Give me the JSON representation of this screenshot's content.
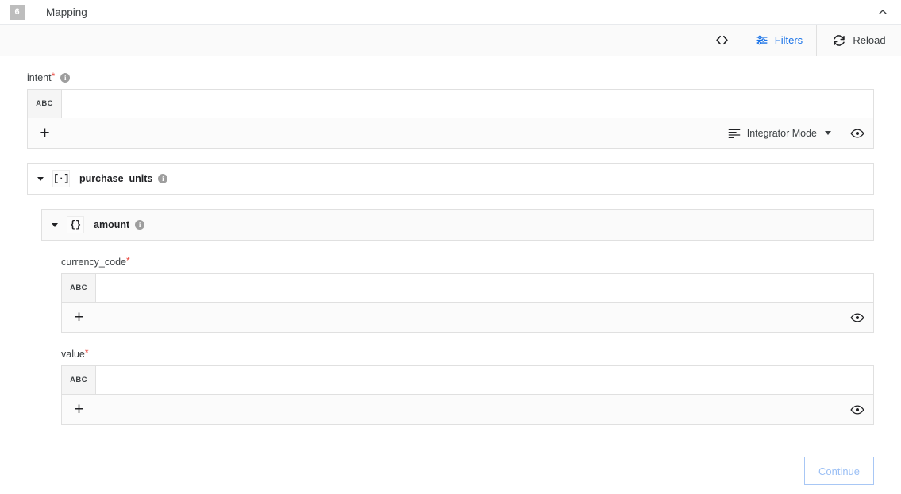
{
  "header": {
    "step_number": "6",
    "title": "Mapping",
    "collapse_icon": "chevron-up-icon"
  },
  "toolbar": {
    "code_icon": "code-brackets-icon",
    "filters_label": "Filters",
    "filters_icon": "tune-sliders-icon",
    "filters_color": "#1a73e8",
    "reload_label": "Reload",
    "reload_icon": "sync-refresh-icon"
  },
  "fields": {
    "intent": {
      "label": "intent",
      "required": "*",
      "has_info": true,
      "info_glyph": "i",
      "type_badge": "ABC",
      "value": "",
      "placeholder": "",
      "add_glyph": "+",
      "mode_label": "Integrator Mode",
      "mode_icon": "list-lines-icon",
      "eye_icon": "eye-preview-icon"
    },
    "currency_code": {
      "label": "currency_code",
      "required": "*",
      "has_info": false,
      "type_badge": "ABC",
      "value": "",
      "placeholder": "",
      "add_glyph": "+",
      "eye_icon": "eye-preview-icon"
    },
    "value": {
      "label": "value",
      "required": "*",
      "has_info": false,
      "type_badge": "ABC",
      "value": "",
      "placeholder": "",
      "add_glyph": "+",
      "eye_icon": "eye-preview-icon"
    }
  },
  "nodes": {
    "purchase_units": {
      "label": "purchase_units",
      "type_glyph": "[·]",
      "type_name": "array",
      "expanded": true,
      "has_info": true,
      "info_glyph": "i"
    },
    "amount": {
      "label": "amount",
      "type_glyph": "{}",
      "type_name": "object",
      "expanded": true,
      "has_info": true,
      "info_glyph": "i"
    }
  },
  "footer": {
    "continue_label": "Continue",
    "continue_disabled": true
  }
}
